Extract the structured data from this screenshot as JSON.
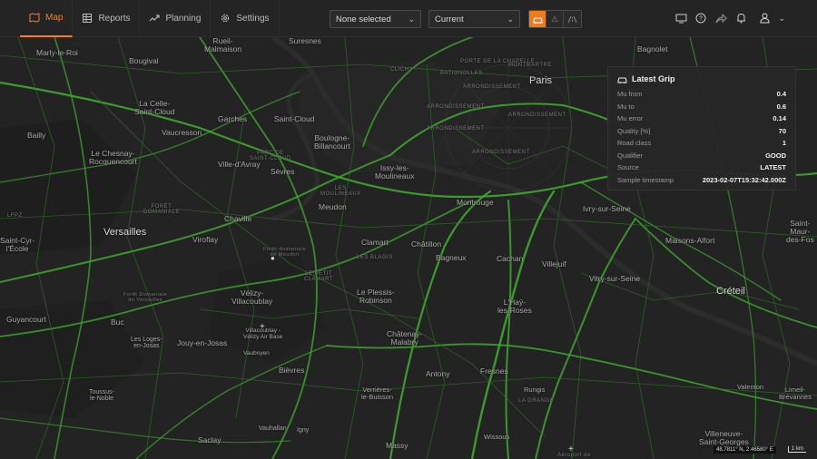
{
  "nav": {
    "tabs": [
      {
        "label": "Map",
        "icon": "map-icon"
      },
      {
        "label": "Reports",
        "icon": "table-icon"
      },
      {
        "label": "Planning",
        "icon": "trend-icon"
      },
      {
        "label": "Settings",
        "icon": "gear-icon"
      }
    ]
  },
  "filters": {
    "selection": "None selected",
    "time": "Current"
  },
  "colors": {
    "accent": "#ff7a1a",
    "road_green": "#3fa82f",
    "map_bg": "#232323"
  },
  "panel": {
    "title": "Latest Grip",
    "rows": [
      {
        "key": "Mu from",
        "value": "0.4"
      },
      {
        "key": "Mu to",
        "value": "0.6"
      },
      {
        "key": "Mu error",
        "value": "0.14"
      },
      {
        "key": "Quality [%]",
        "value": "70"
      },
      {
        "key": "Road class",
        "value": "1"
      },
      {
        "key": "Qualifier",
        "value": "GOOD"
      },
      {
        "key": "Source",
        "value": "LATEST"
      },
      {
        "key": "Sample timestamp",
        "value": "2023-02-07T15:32:42.000Z"
      }
    ]
  },
  "map": {
    "places": [
      "Paris",
      "Suresnes",
      "Rueil-\nMalmaison",
      "Bougival",
      "Marly-le-Roi",
      "Bagnolet",
      "La Celle-\nSaint-Cloud",
      "Garches",
      "Saint-Cloud",
      "Vaucresson",
      "Bailly",
      "Le Chesnay-\nRocquencourt",
      "Ville-d'Avray",
      "Boulogne-\nBillancourt",
      "Sèvres",
      "Issy-les-\nMoulineaux",
      "Versailles",
      "Chaville",
      "Meudon",
      "Montrouge",
      "Ivry-sur-Seine",
      "Viroflay",
      "Clamart",
      "Châtillon",
      "Maisons-Alfort",
      "Bagneux",
      "Cachan",
      "Villejuif",
      "Saint-Cyr-\nl'École",
      "Vélizy-\nVillacoublay",
      "Le Plessis-\nRobinson",
      "Vitry-sur-Seine",
      "Créteil",
      "Guyancourt",
      "Buc",
      "L'Haÿ-\nles-Roses",
      "Villacoublay -\nVélizy Air Base",
      "Jouy-en-Josas",
      "Les Loges-\nen-Josas",
      "Châtenay-\nMalabry",
      "Vauboyen",
      "Bièvres",
      "Antony",
      "Fresnes",
      "Rungis",
      "Toussus-\nle-Noble",
      "Verrières-\nle-Buisson",
      "Vauhallan",
      "Igny",
      "Saclay",
      "Massy",
      "Wissous",
      "Villeneuve-\nSaint-Georges",
      "Valenton",
      "Limeil-\nBrévannes",
      "Saint-\nMaur-\ndes-Fos"
    ],
    "minor_labels": [
      "PORTE DE LA CHAPELLE",
      "BATIGNOLLES",
      "CLICHY",
      "MONTMARTRE",
      "ARRONDISSEMENT",
      "ARRONDISSEMENT",
      "ARRONDISSEMENT",
      "ARRONDISSEMENT",
      "ARRONDISSEMENT",
      "Forêt domaniale\nde Meudon",
      "Forêt Domaniale\nde Versailles",
      "FORÊT\nDOMANIALE",
      "PARC DE\nSAINT-CLOUD",
      "LES\nMOULINEAUX",
      "LE PETIT\nCLAMART",
      "Aéroport de",
      "LFPZ",
      "LES BLAGIS",
      "LA GRANGE"
    ],
    "coordinates": "48.7811° N, 2.46580° E",
    "scale": "1 km"
  }
}
